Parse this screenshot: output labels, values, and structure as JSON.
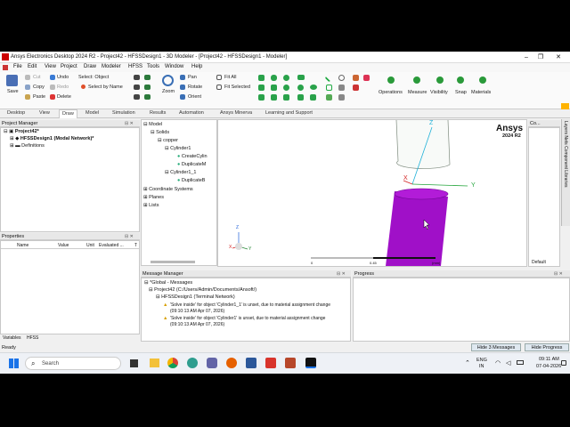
{
  "window": {
    "title": "Ansys Electronics Desktop 2024 R2 - Project42 - HFSSDesign1 - 3D Modeler - [Project42 - HFSSDesign1 - Modeler]"
  },
  "menu": [
    "File",
    "Edit",
    "View",
    "Project",
    "Draw",
    "Modeler",
    "HFSS",
    "Tools",
    "Window",
    "Help"
  ],
  "ribbon": {
    "save": "Save",
    "cut": "Cut",
    "copy": "Copy",
    "paste": "Paste",
    "undo": "Undo",
    "redo": "Redo",
    "delete": "Delete",
    "select_object": "Select: Object",
    "select_by_name": "Select by Name",
    "zoom": "Zoom",
    "pan": "Pan",
    "rotate": "Rotate",
    "orient": "Orient",
    "fit_all": "Fit All",
    "fit_selected": "Fit Selected",
    "operations": "Operations",
    "measure": "Measure",
    "visibility": "Visibility",
    "snap": "Snap",
    "materials": "Materials"
  },
  "tabs": [
    "Desktop",
    "View",
    "Draw",
    "Model",
    "Simulation",
    "Results",
    "Automation",
    "Ansys Minerva",
    "Learning and Support"
  ],
  "active_tab": "Draw",
  "project_manager": {
    "title": "Project Manager",
    "project": "Project42*",
    "design": "HFSSDesign1 (Modal Network)*",
    "definitions": "Definitions"
  },
  "model_tree": {
    "model": "Model",
    "solids": "Solids",
    "copper": "copper",
    "cyl1": "Cylinder1",
    "create": "CreateCylin",
    "dup1": "DuplicateM",
    "cyl1_1": "Cylinder1_1",
    "dup2": "DuplicateB",
    "coord": "Coordinate Systems",
    "planes": "Planes",
    "lists": "Lists"
  },
  "properties": {
    "title": "Properties",
    "cols": [
      "Name",
      "Value",
      "Unit",
      "Evaluated ...",
      "T"
    ],
    "tabs": [
      "Variables",
      "HFSS"
    ]
  },
  "viewport": {
    "brand": "Ansys",
    "version": "2024 R2",
    "axis_z": "Z",
    "axis_y": "Y",
    "axis_x": "X",
    "scale_0": "0",
    "scale_mid": "0.45",
    "scale_unit": "(mm)"
  },
  "message_manager": {
    "title": "Message Manager",
    "global": "*Global - Messages",
    "project": "Project42 (C:/Users/Admin/Documents/Ansoft/)",
    "design": "HFSSDesign1 (Terminal Network)",
    "msg1": "'Solve inside' for object 'Cylinder1_1' is unset, due to material assignment change",
    "time1": "(09:10:13 AM  Apr 07, 2026)",
    "msg2": "'Solve inside' for object 'Cylinder1' is unset, due to material assignment change",
    "time2": "(09:10:13 AM  Apr 07, 2026)"
  },
  "progress": {
    "title": "Progress"
  },
  "side_panel": {
    "title": "Co...",
    "default": "Default",
    "vtabs": "Layers  Nets  Component Libraries"
  },
  "status": {
    "ready": "Ready",
    "hide_messages": "Hide 3 Messages",
    "hide_progress": "Hide Progress"
  },
  "taskbar": {
    "search": "Search",
    "lang": "ENG",
    "region": "IN",
    "time": "09:11 AM",
    "date": "07-04-2026"
  },
  "colors": {
    "purple_cylinder": "#a010c8",
    "accent": "#1a73e8"
  }
}
